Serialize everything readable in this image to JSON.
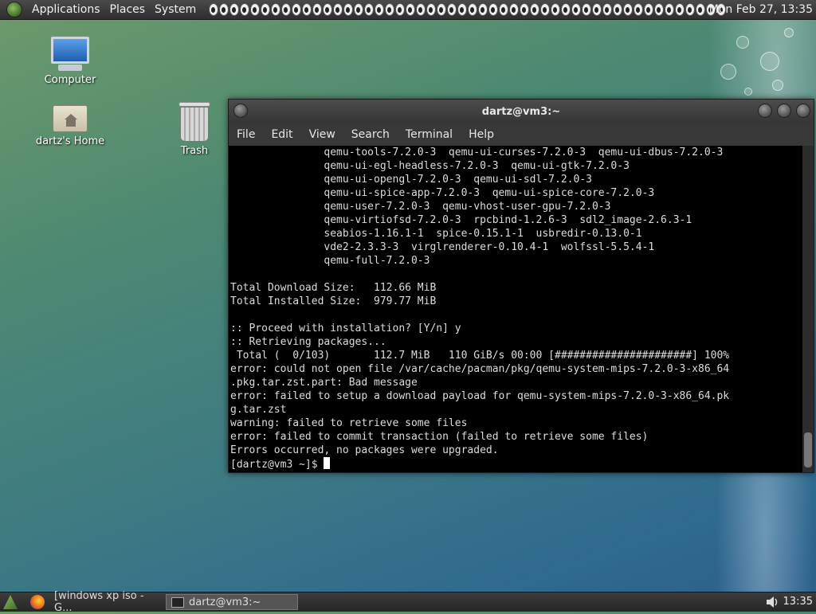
{
  "top_panel": {
    "menus": [
      "Applications",
      "Places",
      "System"
    ],
    "clock": "Mon Feb 27, 13:35"
  },
  "desktop": {
    "icons": [
      {
        "label": "Computer",
        "icon": "computer-icon"
      },
      {
        "label": "dartz's Home",
        "icon": "home-folder-icon"
      },
      {
        "label": "Trash",
        "icon": "trash-icon"
      }
    ]
  },
  "terminal": {
    "title": "dartz@vm3:~",
    "menu": [
      "File",
      "Edit",
      "View",
      "Search",
      "Terminal",
      "Help"
    ],
    "lines": [
      "               qemu-tools-7.2.0-3  qemu-ui-curses-7.2.0-3  qemu-ui-dbus-7.2.0-3",
      "               qemu-ui-egl-headless-7.2.0-3  qemu-ui-gtk-7.2.0-3",
      "               qemu-ui-opengl-7.2.0-3  qemu-ui-sdl-7.2.0-3",
      "               qemu-ui-spice-app-7.2.0-3  qemu-ui-spice-core-7.2.0-3",
      "               qemu-user-7.2.0-3  qemu-vhost-user-gpu-7.2.0-3",
      "               qemu-virtiofsd-7.2.0-3  rpcbind-1.2.6-3  sdl2_image-2.6.3-1",
      "               seabios-1.16.1-1  spice-0.15.1-1  usbredir-0.13.0-1",
      "               vde2-2.3.3-3  virglrenderer-0.10.4-1  wolfssl-5.5.4-1",
      "               qemu-full-7.2.0-3",
      "",
      "Total Download Size:   112.66 MiB",
      "Total Installed Size:  979.77 MiB",
      "",
      ":: Proceed with installation? [Y/n] y",
      ":: Retrieving packages...",
      " Total (  0/103)       112.7 MiB   110 GiB/s 00:00 [######################] 100%",
      "error: could not open file /var/cache/pacman/pkg/qemu-system-mips-7.2.0-3-x86_64",
      ".pkg.tar.zst.part: Bad message",
      "error: failed to setup a download payload for qemu-system-mips-7.2.0-3-x86_64.pk",
      "g.tar.zst",
      "warning: failed to retrieve some files",
      "error: failed to commit transaction (failed to retrieve some files)",
      "Errors occurred, no packages were upgraded."
    ],
    "prompt": "[dartz@vm3 ~]$ "
  },
  "taskbar": {
    "tasks": [
      "[windows xp iso - G...",
      "dartz@vm3:~"
    ],
    "clock": "13:35"
  }
}
